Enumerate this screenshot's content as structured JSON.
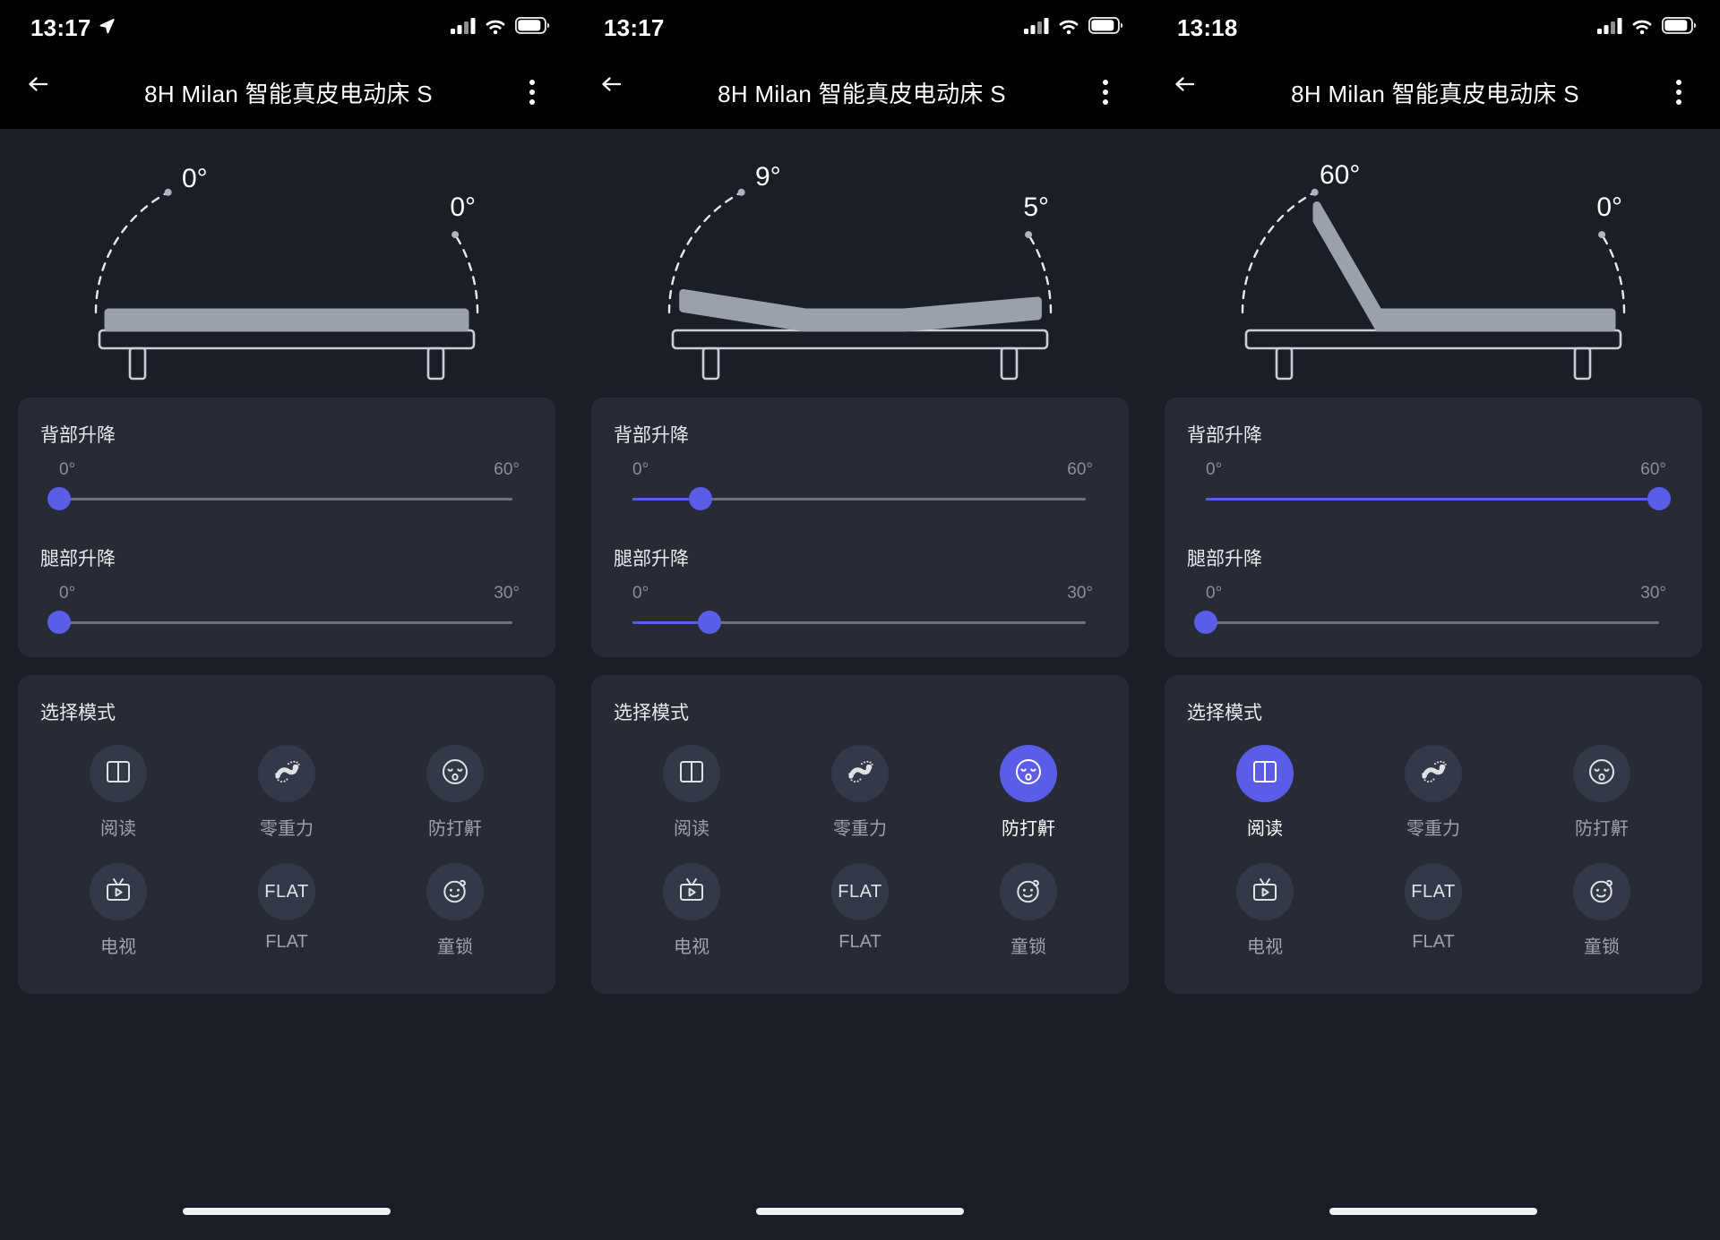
{
  "app": {
    "title": "8H Milan 智能真皮电动床 S",
    "accent_color": "#5b5ce8",
    "page_background": "#1b1e26",
    "card_background": "#272b35",
    "bar_background": "#000000",
    "mattress_color": "#9aa1ad"
  },
  "icons": {
    "back": "back-arrow-icon",
    "menu": "kebab-menu-icon",
    "location": "location-arrow-icon",
    "signal": "signal-bars-icon",
    "wifi": "wifi-icon",
    "battery": "battery-icon"
  },
  "screens": [
    {
      "status": {
        "time": "13:17",
        "location_arrow": true
      },
      "bed": {
        "back_angle_label": "0°",
        "leg_angle_label": "0°",
        "back_angle": 0,
        "leg_angle": 0
      },
      "sliders": {
        "back": {
          "label": "背部升降",
          "min_label": "0°",
          "max_label": "60°",
          "min": 0,
          "max": 60,
          "value": 0,
          "percent": 0
        },
        "leg": {
          "label": "腿部升降",
          "min_label": "0°",
          "max_label": "30°",
          "min": 0,
          "max": 30,
          "value": 0,
          "percent": 0
        }
      },
      "modes": {
        "title": "选择模式",
        "items": [
          {
            "label": "阅读",
            "icon": "book-icon",
            "active": false
          },
          {
            "label": "零重力",
            "icon": "zero-gravity-icon",
            "active": false
          },
          {
            "label": "防打鼾",
            "icon": "sleeping-face-icon",
            "active": false
          },
          {
            "label": "电视",
            "icon": "tv-icon",
            "active": false
          },
          {
            "label": "FLAT",
            "icon": "flat-text-icon",
            "active": false,
            "glyph_text": "FLAT"
          },
          {
            "label": "童锁",
            "icon": "baby-face-icon",
            "active": false
          }
        ]
      }
    },
    {
      "status": {
        "time": "13:17",
        "location_arrow": false
      },
      "bed": {
        "back_angle_label": "9°",
        "leg_angle_label": "5°",
        "back_angle": 9,
        "leg_angle": 5
      },
      "sliders": {
        "back": {
          "label": "背部升降",
          "min_label": "0°",
          "max_label": "60°",
          "min": 0,
          "max": 60,
          "value": 9,
          "percent": 15
        },
        "leg": {
          "label": "腿部升降",
          "min_label": "0°",
          "max_label": "30°",
          "min": 0,
          "max": 30,
          "value": 5,
          "percent": 17
        }
      },
      "modes": {
        "title": "选择模式",
        "items": [
          {
            "label": "阅读",
            "icon": "book-icon",
            "active": false
          },
          {
            "label": "零重力",
            "icon": "zero-gravity-icon",
            "active": false
          },
          {
            "label": "防打鼾",
            "icon": "sleeping-face-icon",
            "active": true
          },
          {
            "label": "电视",
            "icon": "tv-icon",
            "active": false
          },
          {
            "label": "FLAT",
            "icon": "flat-text-icon",
            "active": false,
            "glyph_text": "FLAT"
          },
          {
            "label": "童锁",
            "icon": "baby-face-icon",
            "active": false
          }
        ]
      }
    },
    {
      "status": {
        "time": "13:18",
        "location_arrow": false
      },
      "bed": {
        "back_angle_label": "60°",
        "leg_angle_label": "0°",
        "back_angle": 60,
        "leg_angle": 0
      },
      "sliders": {
        "back": {
          "label": "背部升降",
          "min_label": "0°",
          "max_label": "60°",
          "min": 0,
          "max": 60,
          "value": 60,
          "percent": 100
        },
        "leg": {
          "label": "腿部升降",
          "min_label": "0°",
          "max_label": "30°",
          "min": 0,
          "max": 30,
          "value": 0,
          "percent": 0
        }
      },
      "modes": {
        "title": "选择模式",
        "items": [
          {
            "label": "阅读",
            "icon": "book-icon",
            "active": true
          },
          {
            "label": "零重力",
            "icon": "zero-gravity-icon",
            "active": false
          },
          {
            "label": "防打鼾",
            "icon": "sleeping-face-icon",
            "active": false
          },
          {
            "label": "电视",
            "icon": "tv-icon",
            "active": false
          },
          {
            "label": "FLAT",
            "icon": "flat-text-icon",
            "active": false,
            "glyph_text": "FLAT"
          },
          {
            "label": "童锁",
            "icon": "baby-face-icon",
            "active": false
          }
        ]
      }
    }
  ]
}
